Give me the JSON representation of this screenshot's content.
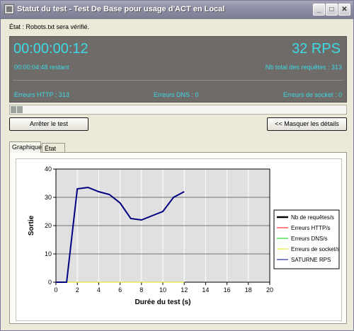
{
  "window": {
    "title": "Statut du test - Test De Base pour usage d'ACT en Local",
    "buttons": {
      "minimize": "_",
      "maximize": "□",
      "close": "✕"
    }
  },
  "status_text": "État : Robots.txt sera vérifié.",
  "panel": {
    "elapsed": "00:00:00:12",
    "rps": "32 RPS",
    "remaining": "00:00:04:48 restant",
    "total_requests": "Nb total des requêtes : 313",
    "http_errors": "Erreurs HTTP : 313",
    "dns_errors": "Erreurs DNS : 0",
    "socket_errors": "Erreurs de socket : 0"
  },
  "progress": {
    "fraction": 0.04
  },
  "buttons": {
    "stop": "Arrêter le test",
    "hide_details": "<< Masquer les détails"
  },
  "tabs": [
    {
      "label": "Graphique",
      "active": true
    },
    {
      "label": "État",
      "active": false
    }
  ],
  "chart_data": {
    "type": "line",
    "xlabel": "Durée du test (s)",
    "ylabel": "Sortie",
    "xlim": [
      0,
      20
    ],
    "ylim": [
      0,
      40
    ],
    "xticks": [
      "0",
      "2",
      "4",
      "6",
      "8",
      "10",
      "12",
      "14",
      "16",
      "18",
      "20"
    ],
    "yticks": [
      "0",
      "10",
      "20",
      "30",
      "40"
    ],
    "grid": true,
    "legend_position": "right",
    "series": [
      {
        "name": "Nb de requêtes/s",
        "color": "#000000",
        "x": [],
        "y": []
      },
      {
        "name": "Erreurs HTTP/s",
        "color": "#ff0000",
        "x": [
          0,
          12
        ],
        "y": [
          0,
          0
        ]
      },
      {
        "name": "Erreurs DNS/s",
        "color": "#00cc00",
        "x": [
          0,
          12
        ],
        "y": [
          0,
          0
        ]
      },
      {
        "name": "Erreurs de socket/s",
        "color": "#e6e600",
        "x": [
          0,
          12
        ],
        "y": [
          0,
          0
        ]
      },
      {
        "name": "SATURNE RPS",
        "color": "#000080",
        "x": [
          0,
          1,
          2,
          3,
          4,
          5,
          6,
          7,
          8,
          9,
          10,
          11,
          12
        ],
        "y": [
          0,
          0,
          33,
          33.5,
          32,
          31,
          28,
          22.5,
          22,
          23.5,
          25,
          30,
          32
        ]
      }
    ]
  }
}
